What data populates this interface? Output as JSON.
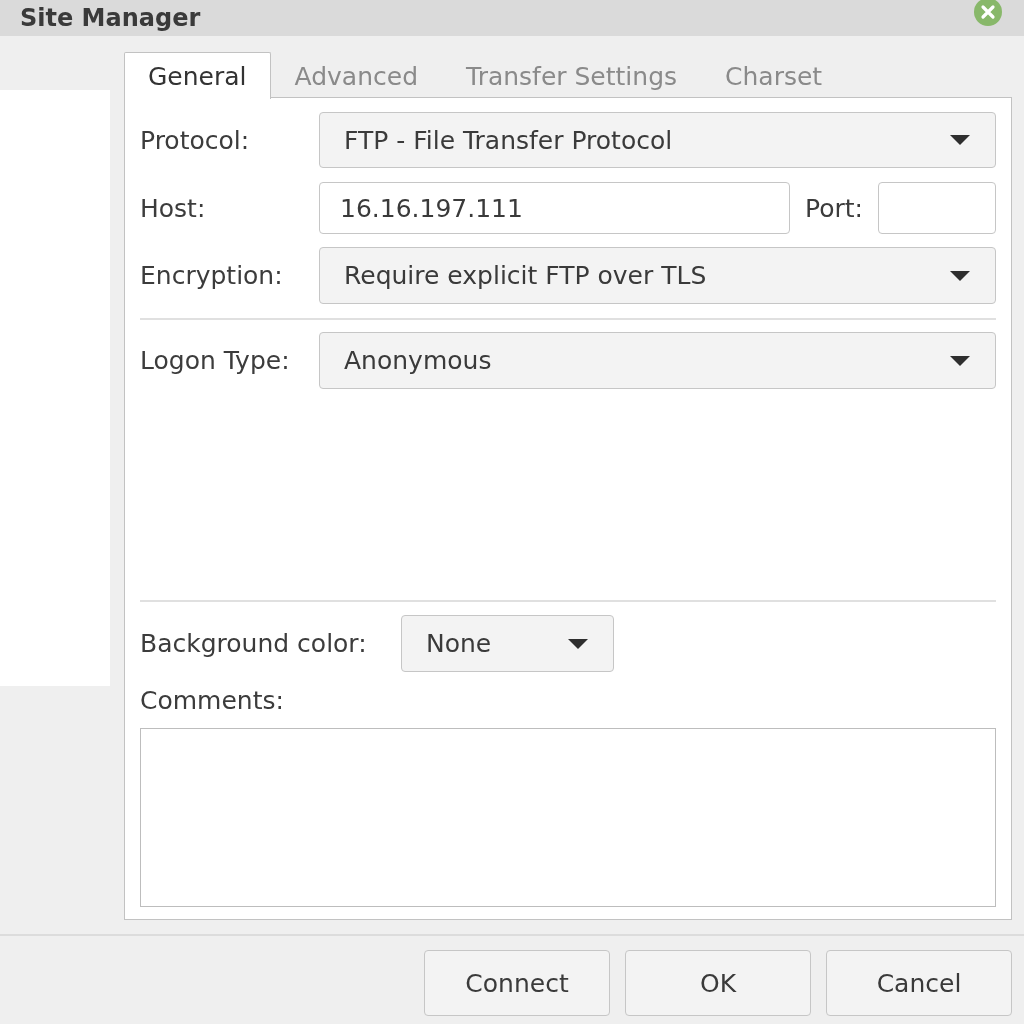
{
  "window": {
    "title": "Site Manager"
  },
  "tabs": [
    {
      "label": "General",
      "selected": true
    },
    {
      "label": "Advanced",
      "selected": false
    },
    {
      "label": "Transfer Settings",
      "selected": false
    },
    {
      "label": "Charset",
      "selected": false
    }
  ],
  "general": {
    "protocol": {
      "label": "Protocol:",
      "value": "FTP - File Transfer Protocol"
    },
    "host": {
      "label": "Host:",
      "value": "16.16.197.111"
    },
    "port": {
      "label": "Port:"
    },
    "encryption": {
      "label": "Encryption:",
      "value": "Require explicit FTP over TLS"
    },
    "logon_type": {
      "label": "Logon Type:",
      "value": "Anonymous"
    },
    "background_color": {
      "label": "Background color:",
      "value": "None"
    },
    "comments": {
      "label": "Comments:"
    }
  },
  "buttons": [
    {
      "label": "Connect"
    },
    {
      "label": "OK"
    },
    {
      "label": "Cancel"
    }
  ]
}
